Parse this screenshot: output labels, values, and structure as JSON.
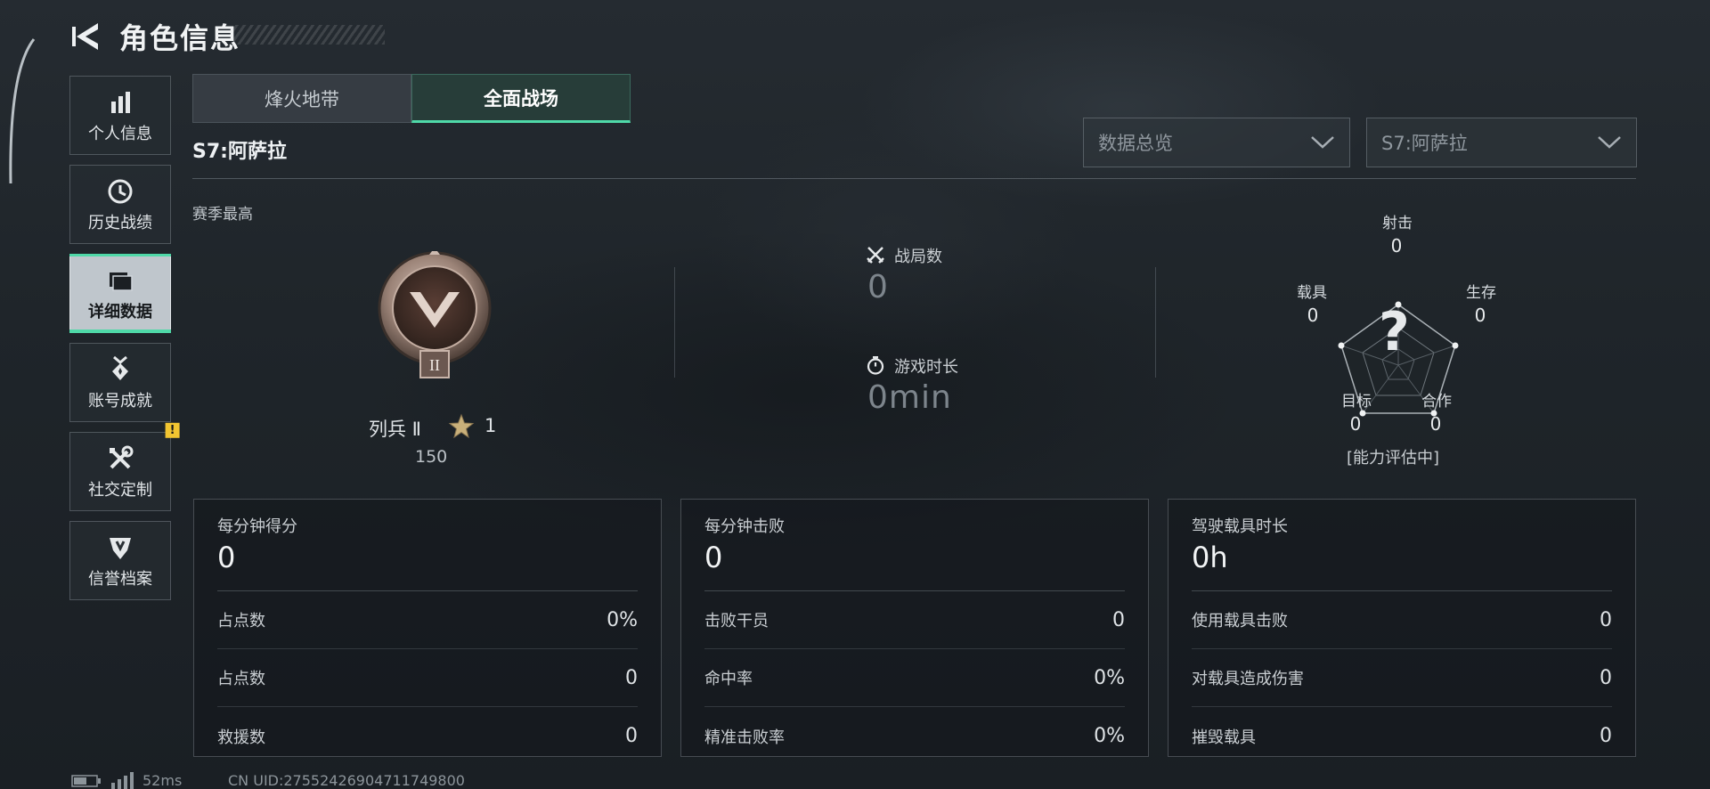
{
  "header": {
    "title": "角色信息"
  },
  "nav": [
    {
      "label": "个人信息",
      "icon": "bar-chart-icon",
      "active": false,
      "alert": false
    },
    {
      "label": "历史战绩",
      "icon": "history-clock-icon",
      "active": false,
      "alert": false
    },
    {
      "label": "详细数据",
      "icon": "folder-icon",
      "active": true,
      "alert": false
    },
    {
      "label": "账号成就",
      "icon": "medal-icon",
      "active": false,
      "alert": false
    },
    {
      "label": "社交定制",
      "icon": "tools-icon",
      "active": false,
      "alert": true
    },
    {
      "label": "信誉档案",
      "icon": "shield-emblem-icon",
      "active": false,
      "alert": false
    }
  ],
  "nav_alert_text": "!",
  "tabs": [
    {
      "label": "烽火地带",
      "active": false
    },
    {
      "label": "全面战场",
      "active": true
    }
  ],
  "season": "S7:阿萨拉",
  "filters": {
    "data_type": "数据总览",
    "season": "S7:阿萨拉"
  },
  "best_label": "赛季最高",
  "rank": {
    "emblem_numeral": "II",
    "name": "列兵 Ⅱ",
    "stars": "1",
    "points": "150"
  },
  "match_stats": {
    "matches_label": "战局数",
    "matches_value": "0",
    "playtime_label": "游戏时长",
    "playtime_value": "0min"
  },
  "radar": {
    "axes": [
      {
        "label": "射击",
        "value": "0"
      },
      {
        "label": "生存",
        "value": "0"
      },
      {
        "label": "合作",
        "value": "0"
      },
      {
        "label": "目标",
        "value": "0"
      },
      {
        "label": "载具",
        "value": "0"
      }
    ],
    "center_mark": "?",
    "status": "[能力评估中]"
  },
  "cards": [
    {
      "title": "每分钟得分",
      "value": "0",
      "rows": [
        {
          "label": "占点数",
          "value": "0%"
        },
        {
          "label": "占点数",
          "value": "0"
        },
        {
          "label": "救援数",
          "value": "0"
        }
      ]
    },
    {
      "title": "每分钟击败",
      "value": "0",
      "rows": [
        {
          "label": "击败干员",
          "value": "0"
        },
        {
          "label": "命中率",
          "value": "0%"
        },
        {
          "label": "精准击败率",
          "value": "0%"
        }
      ]
    },
    {
      "title": "驾驶载具时长",
      "value": "0h",
      "rows": [
        {
          "label": "使用载具击败",
          "value": "0"
        },
        {
          "label": "对载具造成伤害",
          "value": "0"
        },
        {
          "label": "摧毁载具",
          "value": "0"
        }
      ]
    }
  ],
  "footer": {
    "ping": "52ms",
    "uid": "CN UID:27552426904711749800"
  },
  "colors": {
    "accent": "#4fd9a8",
    "alert": "#f2c531"
  }
}
